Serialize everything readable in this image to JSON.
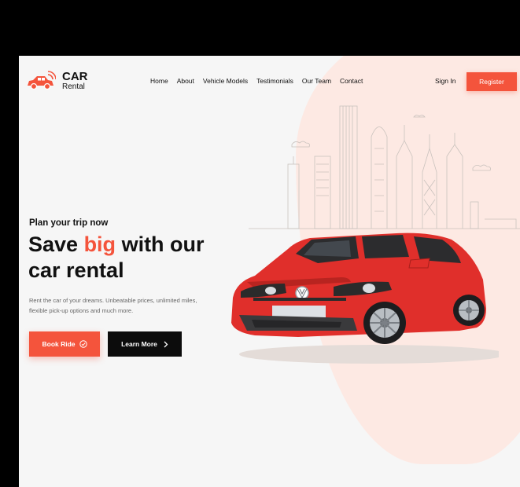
{
  "brand": {
    "name_top": "CAR",
    "name_bottom": "Rental",
    "accent_color": "#f4543c"
  },
  "nav": {
    "items": [
      "Home",
      "About",
      "Vehicle Models",
      "Testimonials",
      "Our Team",
      "Contact"
    ]
  },
  "auth": {
    "signin_label": "Sign In",
    "register_label": "Register"
  },
  "hero": {
    "eyebrow": "Plan your trip now",
    "headline_part1": "Save ",
    "headline_accent": "big",
    "headline_part2": " with our",
    "headline_line2": "car rental",
    "description_line1": "Rent the car of your dreams. Unbeatable prices, unlimited miles,",
    "description_line2": "flexible pick-up options and much more.",
    "book_label": "Book Ride",
    "learn_label": "Learn More",
    "plate_text": ""
  },
  "icons": {
    "logo": "car-with-signal-icon",
    "book": "check-circle-icon",
    "learn": "chevron-right-icon"
  }
}
